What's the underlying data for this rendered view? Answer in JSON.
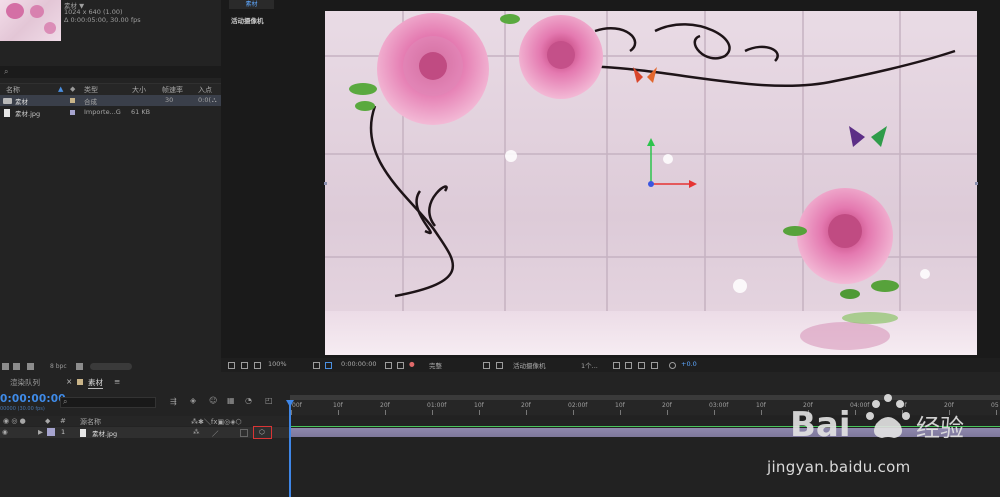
{
  "project": {
    "thumbnail_info": {
      "name": "素材 ▼",
      "resolution": "1024 x 640 (1.00)",
      "duration": "Δ 0:00:05:00, 30.00 fps"
    },
    "search_placeholder": "",
    "columns": {
      "name": "名称",
      "type": "类型",
      "size": "大小",
      "fps": "帧速率",
      "in": "入点"
    },
    "items": [
      {
        "name": "素材",
        "type": "合成",
        "size": "",
        "fps": "30",
        "in": "0:0("
      },
      {
        "name": "素材.jpg",
        "type": "Importe...G",
        "size": "61 KB",
        "fps": "",
        "in": ""
      }
    ],
    "bpc": "8 bpc"
  },
  "viewer": {
    "tab_label": "素材",
    "camera_label": "活动摄像机",
    "toolbar": {
      "zoom": "100%",
      "timecode": "0:00:00:00",
      "resolution": "完整",
      "camera": "活动摄像机",
      "views": "1个...",
      "exposure": "+0.0"
    }
  },
  "timeline": {
    "tabs": {
      "render_queue": "渲染队列",
      "comp": "素材"
    },
    "timecode": "0:00:00:00",
    "fps_info": "00000 (30.00 fps)",
    "ruler_ticks": [
      "00f",
      "10f",
      "20f",
      "01:00f",
      "10f",
      "20f",
      "02:00f",
      "10f",
      "20f",
      "03:00f",
      "10f",
      "20f",
      "04:00f",
      "10f",
      "20f",
      "05"
    ],
    "columns": {
      "source_name": "源名称"
    },
    "layers": [
      {
        "index": "1",
        "name": "素材.jpg"
      }
    ]
  },
  "watermark": {
    "brand": "Bai 经验",
    "url": "jingyan.baidu.com"
  },
  "colors": {
    "accent_blue": "#3f8be8",
    "layer_bar": "#8e88ad",
    "highlight": "#d93535",
    "panel_bg": "#232323"
  }
}
